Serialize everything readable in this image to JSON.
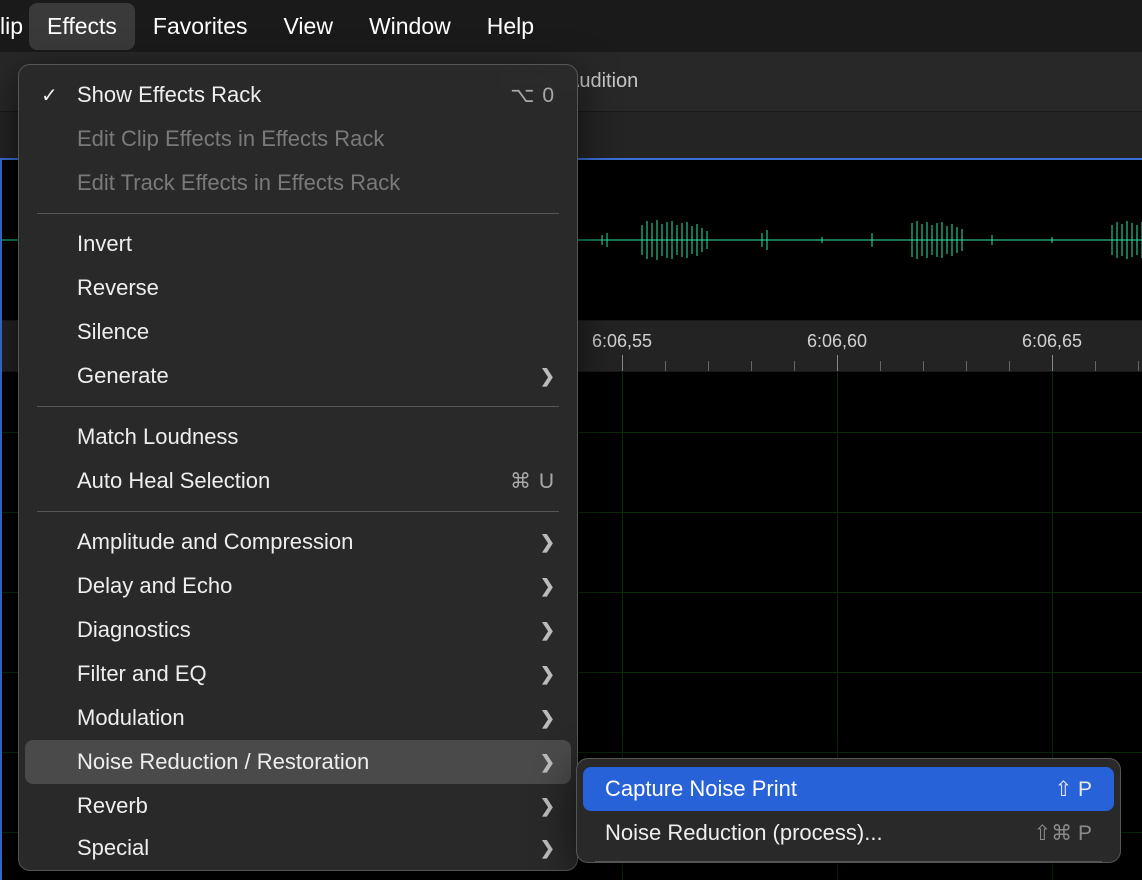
{
  "menubar": {
    "clip": "lip",
    "items": [
      {
        "label": "Effects",
        "active": true
      },
      {
        "label": "Favorites",
        "active": false
      },
      {
        "label": "View",
        "active": false
      },
      {
        "label": "Window",
        "active": false
      },
      {
        "label": "Help",
        "active": false
      }
    ]
  },
  "app": {
    "title": "Adobe Audition"
  },
  "timeline": {
    "labels": [
      "6:06,55",
      "6:06,60",
      "6:06,65"
    ]
  },
  "effects_menu": {
    "items": [
      {
        "type": "item",
        "label": "Show Effects Rack",
        "checked": true,
        "shortcut": "⌥ 0"
      },
      {
        "type": "item",
        "label": "Edit Clip Effects in Effects Rack",
        "disabled": true
      },
      {
        "type": "item",
        "label": "Edit Track Effects in Effects Rack",
        "disabled": true
      },
      {
        "type": "sep"
      },
      {
        "type": "item",
        "label": "Invert"
      },
      {
        "type": "item",
        "label": "Reverse"
      },
      {
        "type": "item",
        "label": "Silence"
      },
      {
        "type": "item",
        "label": "Generate",
        "submenu": true
      },
      {
        "type": "sep"
      },
      {
        "type": "item",
        "label": "Match Loudness"
      },
      {
        "type": "item",
        "label": "Auto Heal Selection",
        "shortcut": "⌘ U"
      },
      {
        "type": "sep"
      },
      {
        "type": "item",
        "label": "Amplitude and Compression",
        "submenu": true
      },
      {
        "type": "item",
        "label": "Delay and Echo",
        "submenu": true
      },
      {
        "type": "item",
        "label": "Diagnostics",
        "submenu": true
      },
      {
        "type": "item",
        "label": "Filter and EQ",
        "submenu": true
      },
      {
        "type": "item",
        "label": "Modulation",
        "submenu": true
      },
      {
        "type": "item",
        "label": "Noise Reduction / Restoration",
        "submenu": true,
        "hover": true
      },
      {
        "type": "item",
        "label": "Reverb",
        "submenu": true
      },
      {
        "type": "item",
        "label": "Special",
        "submenu": true
      }
    ]
  },
  "noise_submenu": {
    "items": [
      {
        "label": "Capture Noise Print",
        "shortcut": "⇧ P",
        "selected": true
      },
      {
        "label": "Noise Reduction (process)...",
        "shortcut": "⇧⌘ P",
        "dim": true
      }
    ]
  }
}
